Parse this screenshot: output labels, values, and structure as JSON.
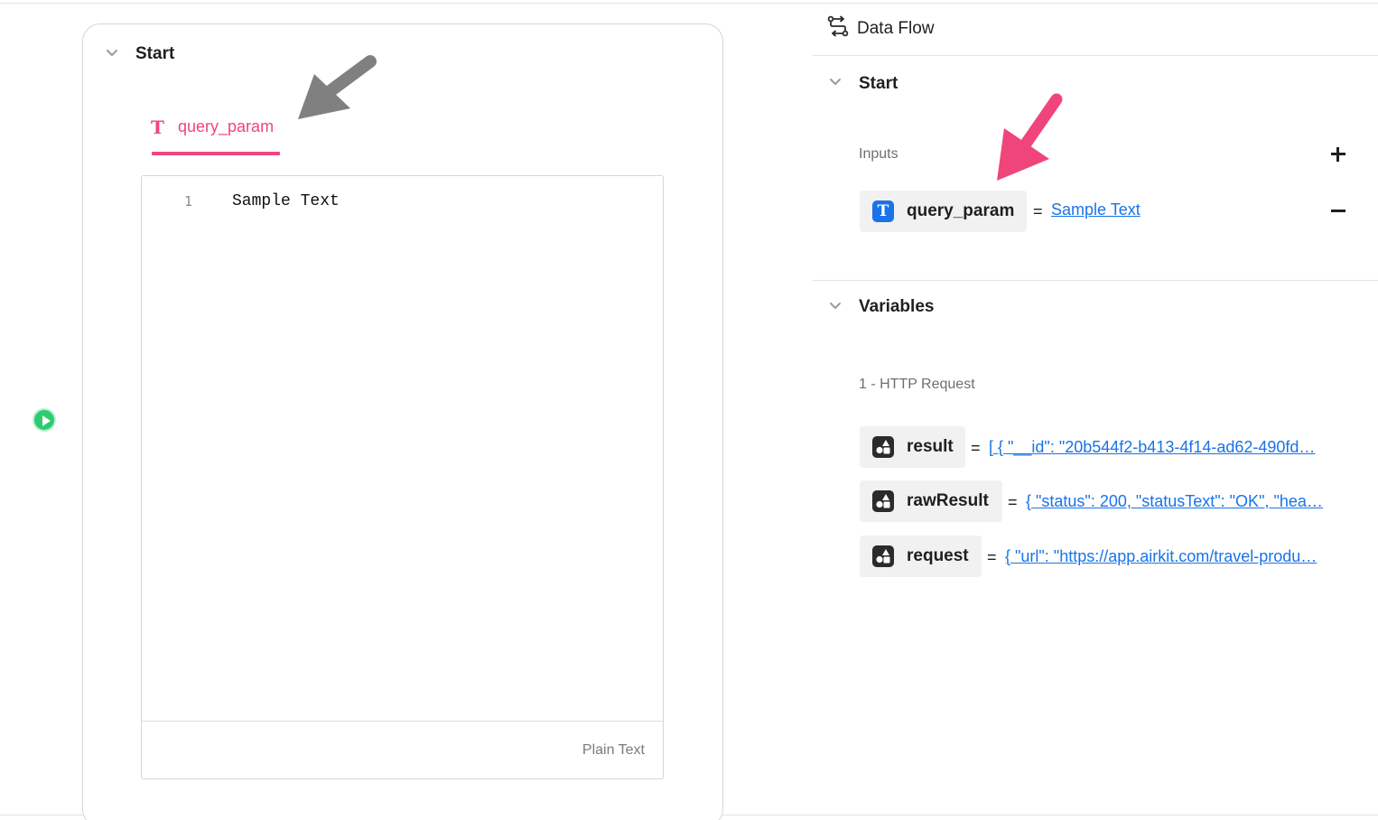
{
  "canvas": {
    "start_card": {
      "title": "Start",
      "tab": {
        "icon": "text-type-icon",
        "icon_glyph": "T",
        "label": "query_param"
      },
      "editor": {
        "line_number": "1",
        "code": "Sample Text",
        "language": "Plain Text"
      }
    },
    "run_button": {
      "icon": "play-icon"
    }
  },
  "panel": {
    "title": "Data Flow",
    "header_icon": "data-flow-icon",
    "start_section": {
      "title": "Start",
      "inputs_label": "Inputs",
      "inputs": [
        {
          "icon_glyph": "T",
          "name": "query_param",
          "equals": "=",
          "value": "Sample Text"
        }
      ]
    },
    "variables_section": {
      "title": "Variables",
      "group_label": "1 - HTTP Request",
      "items": [
        {
          "name": "result",
          "equals": "=",
          "value": "[ { \"__id\": \"20b544f2-b413-4f14-ad62-490fd…"
        },
        {
          "name": "rawResult",
          "equals": "=",
          "value": "{ \"status\": 200, \"statusText\": \"OK\", \"hea…"
        },
        {
          "name": "request",
          "equals": "=",
          "value": "{ \"url\": \"https://app.airkit.com/travel-produ…"
        }
      ]
    }
  },
  "colors": {
    "accent_pink": "#f0457a",
    "link_blue": "#1a73e8",
    "run_green": "#2ecc71",
    "annotation_gray": "#808080"
  }
}
